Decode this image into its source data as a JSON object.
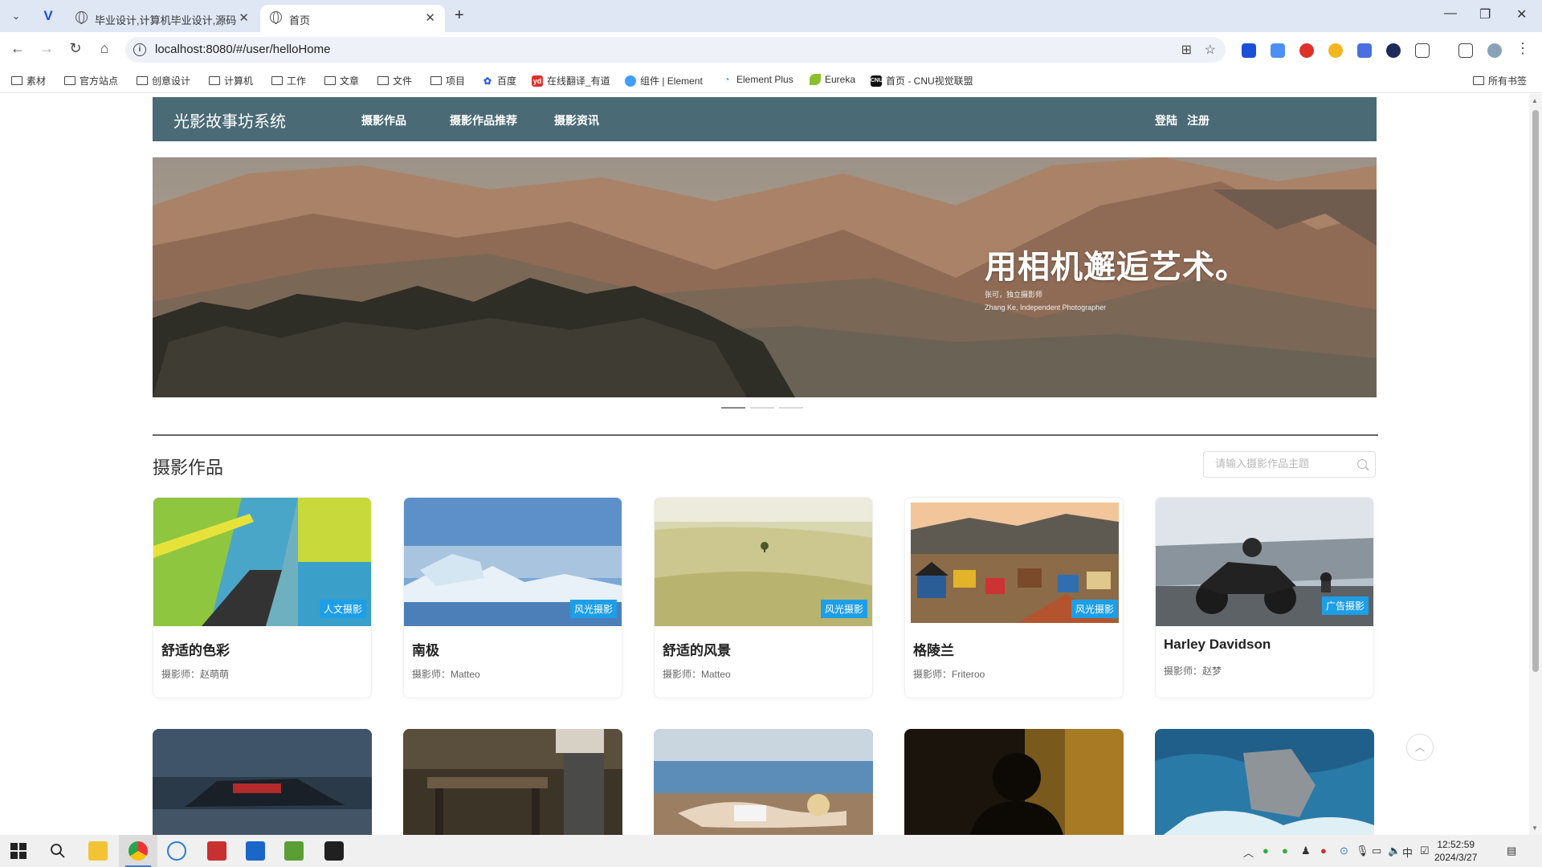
{
  "browser": {
    "tabs": [
      {
        "title": "毕业设计,计算机毕业设计,源码"
      },
      {
        "title": "首页"
      }
    ],
    "url": "localhost:8080/#/user/helloHome",
    "bookmarks": [
      {
        "label": "素材",
        "kind": "folder"
      },
      {
        "label": "官方站点",
        "kind": "folder"
      },
      {
        "label": "创意设计",
        "kind": "folder"
      },
      {
        "label": "计算机",
        "kind": "folder"
      },
      {
        "label": "工作",
        "kind": "folder"
      },
      {
        "label": "文章",
        "kind": "folder"
      },
      {
        "label": "文件",
        "kind": "folder"
      },
      {
        "label": "项目",
        "kind": "folder"
      },
      {
        "label": "百度",
        "kind": "site"
      },
      {
        "label": "在线翻译_有道",
        "kind": "site"
      },
      {
        "label": "组件 | Element",
        "kind": "site"
      },
      {
        "label": "Element Plus",
        "kind": "site"
      },
      {
        "label": "Eureka",
        "kind": "site"
      },
      {
        "label": "首页 - CNU视觉联盟",
        "kind": "site"
      }
    ],
    "all_bookmarks": "所有书签"
  },
  "site": {
    "logo": "光影故事坊系统",
    "menu": [
      "摄影作品",
      "摄影作品推荐",
      "摄影资讯"
    ],
    "login": "登陆",
    "register": "注册"
  },
  "hero": {
    "title": "用相机邂逅艺术。",
    "subtitle_cn": "张可，独立摄影师",
    "subtitle_en": "Zhang Ke, Independent Photographer",
    "slide_count": 3,
    "active_slide": 1
  },
  "works": {
    "section_title": "摄影作品",
    "search_placeholder": "请输入摄影作品主题",
    "items": [
      {
        "title": "舒适的色彩",
        "author": "摄影师：赵萌萌",
        "badge": "人文摄影"
      },
      {
        "title": "南极",
        "author": "摄影师：Matteo",
        "badge": "风光摄影"
      },
      {
        "title": "舒适的风景",
        "author": "摄影师：Matteo",
        "badge": "风光摄影"
      },
      {
        "title": "格陵兰",
        "author": "摄影师：Friteroo",
        "badge": "风光摄影"
      },
      {
        "title": "Harley Davidson",
        "author": "摄影师：赵梦",
        "badge": "广告摄影"
      }
    ]
  },
  "taskbar": {
    "time": "12:52:59",
    "date": "2024/3/27",
    "ime": "中"
  },
  "colors": {
    "nav_bg": "#4a6a75",
    "badge_bg": "#1e9ee6"
  }
}
